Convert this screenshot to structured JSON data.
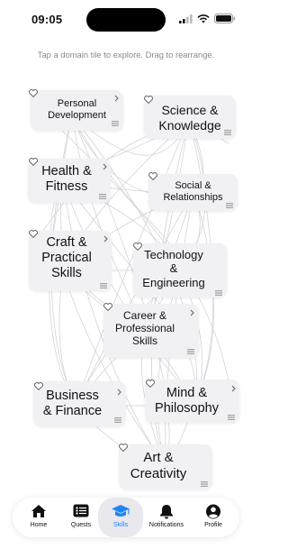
{
  "status_bar": {
    "time": "09:05"
  },
  "instruction": "Tap a domain tile to explore. Drag to rearrange.",
  "tiles": [
    {
      "label": "Personal\nDevelopment"
    },
    {
      "label": "Science &\nKnowledge"
    },
    {
      "label": "Health &\nFitness"
    },
    {
      "label": "Social &\nRelationships"
    },
    {
      "label": "Craft &\nPractical\nSkills"
    },
    {
      "label": "Technology\n&\nEngineering"
    },
    {
      "label": "Career &\nProfessional\nSkills"
    },
    {
      "label": "Business\n& Finance"
    },
    {
      "label": "Mind &\nPhilosophy"
    },
    {
      "label": "Art &\nCreativity"
    }
  ],
  "tabbar": {
    "tabs": [
      {
        "label": "Home",
        "icon": "house-icon"
      },
      {
        "label": "Quests",
        "icon": "list-icon"
      },
      {
        "label": "Skills",
        "icon": "graduation-cap-icon"
      },
      {
        "label": "Notifications",
        "icon": "bell-icon"
      },
      {
        "label": "Profile",
        "icon": "person-icon"
      }
    ],
    "active": "Skills"
  },
  "colors": {
    "accent": "#1f86f0",
    "tile_bg": "#f1f1f4",
    "web_line": "#cfcfd4"
  }
}
